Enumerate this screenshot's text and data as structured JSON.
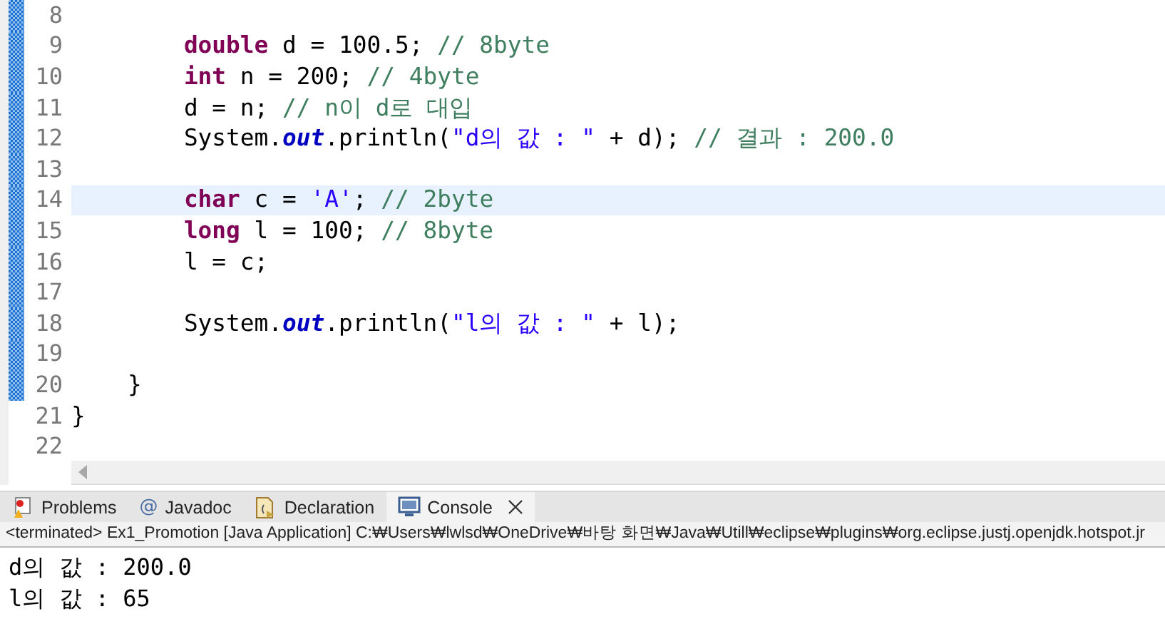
{
  "editor": {
    "lines": [
      {
        "number": "8",
        "marked": true,
        "current": false
      },
      {
        "number": "9",
        "marked": true,
        "current": false,
        "tokens": [
          {
            "kind": "keyword",
            "text": "        double"
          },
          {
            "kind": "plain",
            "text": " d = 100.5; "
          },
          {
            "kind": "comment",
            "text": "// 8byte"
          }
        ]
      },
      {
        "number": "10",
        "marked": true,
        "current": false,
        "tokens": [
          {
            "kind": "keyword",
            "text": "        int"
          },
          {
            "kind": "plain",
            "text": " n = 200; "
          },
          {
            "kind": "comment",
            "text": "// 4byte"
          }
        ]
      },
      {
        "number": "11",
        "marked": true,
        "current": false,
        "tokens": [
          {
            "kind": "plain",
            "text": "        d = n; "
          },
          {
            "kind": "comment",
            "text": "// n이 d로 대입"
          }
        ]
      },
      {
        "number": "12",
        "marked": true,
        "current": false,
        "tokens": [
          {
            "kind": "plain",
            "text": "        System."
          },
          {
            "kind": "field",
            "text": "out"
          },
          {
            "kind": "plain",
            "text": ".println("
          },
          {
            "kind": "string",
            "text": "\"d의 값 : \""
          },
          {
            "kind": "plain",
            "text": " + d); "
          },
          {
            "kind": "comment",
            "text": "// 결과 : 200.0"
          }
        ]
      },
      {
        "number": "13",
        "marked": true,
        "current": false
      },
      {
        "number": "14",
        "marked": true,
        "current": true,
        "tokens": [
          {
            "kind": "keyword",
            "text": "        char"
          },
          {
            "kind": "plain",
            "text": " c = "
          },
          {
            "kind": "string",
            "text": "'A'"
          },
          {
            "kind": "plain",
            "text": "; "
          },
          {
            "kind": "comment",
            "text": "// 2byte"
          }
        ]
      },
      {
        "number": "15",
        "marked": true,
        "current": false,
        "tokens": [
          {
            "kind": "keyword",
            "text": "        long"
          },
          {
            "kind": "plain",
            "text": " l = 100; "
          },
          {
            "kind": "comment",
            "text": "// 8byte"
          }
        ]
      },
      {
        "number": "16",
        "marked": true,
        "current": false,
        "tokens": [
          {
            "kind": "plain",
            "text": "        l = c;"
          }
        ]
      },
      {
        "number": "17",
        "marked": true,
        "current": false
      },
      {
        "number": "18",
        "marked": true,
        "current": false,
        "tokens": [
          {
            "kind": "plain",
            "text": "        System."
          },
          {
            "kind": "field",
            "text": "out"
          },
          {
            "kind": "plain",
            "text": ".println("
          },
          {
            "kind": "string",
            "text": "\"l의 값 : \""
          },
          {
            "kind": "plain",
            "text": " + l);"
          }
        ]
      },
      {
        "number": "19",
        "marked": true,
        "current": false
      },
      {
        "number": "20",
        "marked": true,
        "current": false,
        "tokens": [
          {
            "kind": "plain",
            "text": "    }"
          }
        ]
      },
      {
        "number": "21",
        "marked": false,
        "current": false,
        "tokens": [
          {
            "kind": "plain",
            "text": "}"
          }
        ]
      },
      {
        "number": "22",
        "marked": false,
        "current": false
      }
    ]
  },
  "tabs": [
    {
      "label": "Problems",
      "kind": "problems",
      "selected": false,
      "closable": false
    },
    {
      "label": "Javadoc",
      "kind": "glyph",
      "glyph": "@",
      "selected": false,
      "closable": false
    },
    {
      "label": "Declaration",
      "kind": "declaration",
      "selected": false,
      "closable": false
    },
    {
      "label": "Console",
      "kind": "console",
      "selected": true,
      "closable": true
    }
  ],
  "console": {
    "status": "<terminated> Ex1_Promotion [Java Application] C:₩Users₩lwlsd₩OneDrive₩바탕 화면₩Java₩Utill₩eclipse₩plugins₩org.eclipse.justj.openjdk.hotspot.jr",
    "output": [
      "d의 값 : 200.0",
      "l의 값 : 65"
    ]
  }
}
